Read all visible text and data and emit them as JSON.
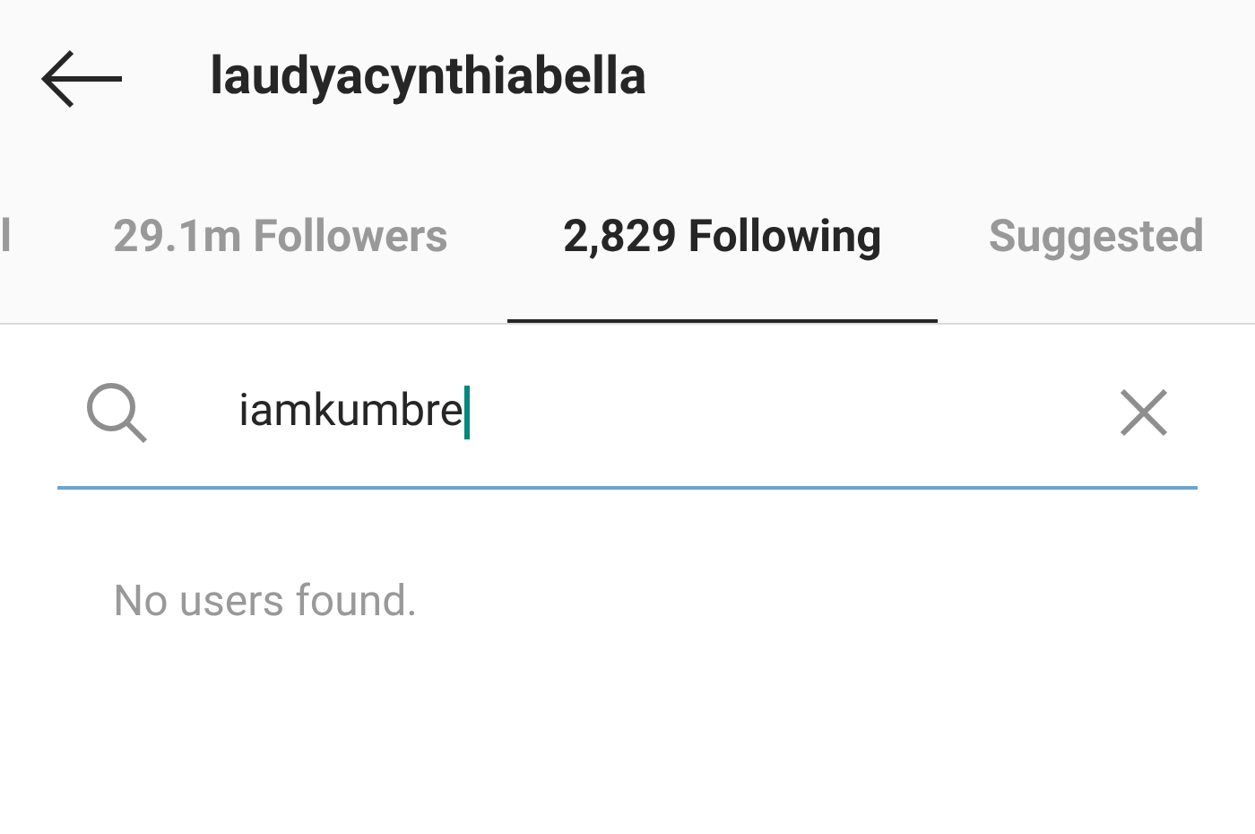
{
  "header": {
    "title": "laudyacynthiabella"
  },
  "tabs": [
    {
      "label": "l",
      "selected": false
    },
    {
      "label": "29.1m Followers",
      "selected": false
    },
    {
      "label": "2,829 Following",
      "selected": true
    },
    {
      "label": "Suggested",
      "selected": false
    }
  ],
  "search": {
    "value": "iamkumbre",
    "focused": true
  },
  "empty_message": "No users found."
}
